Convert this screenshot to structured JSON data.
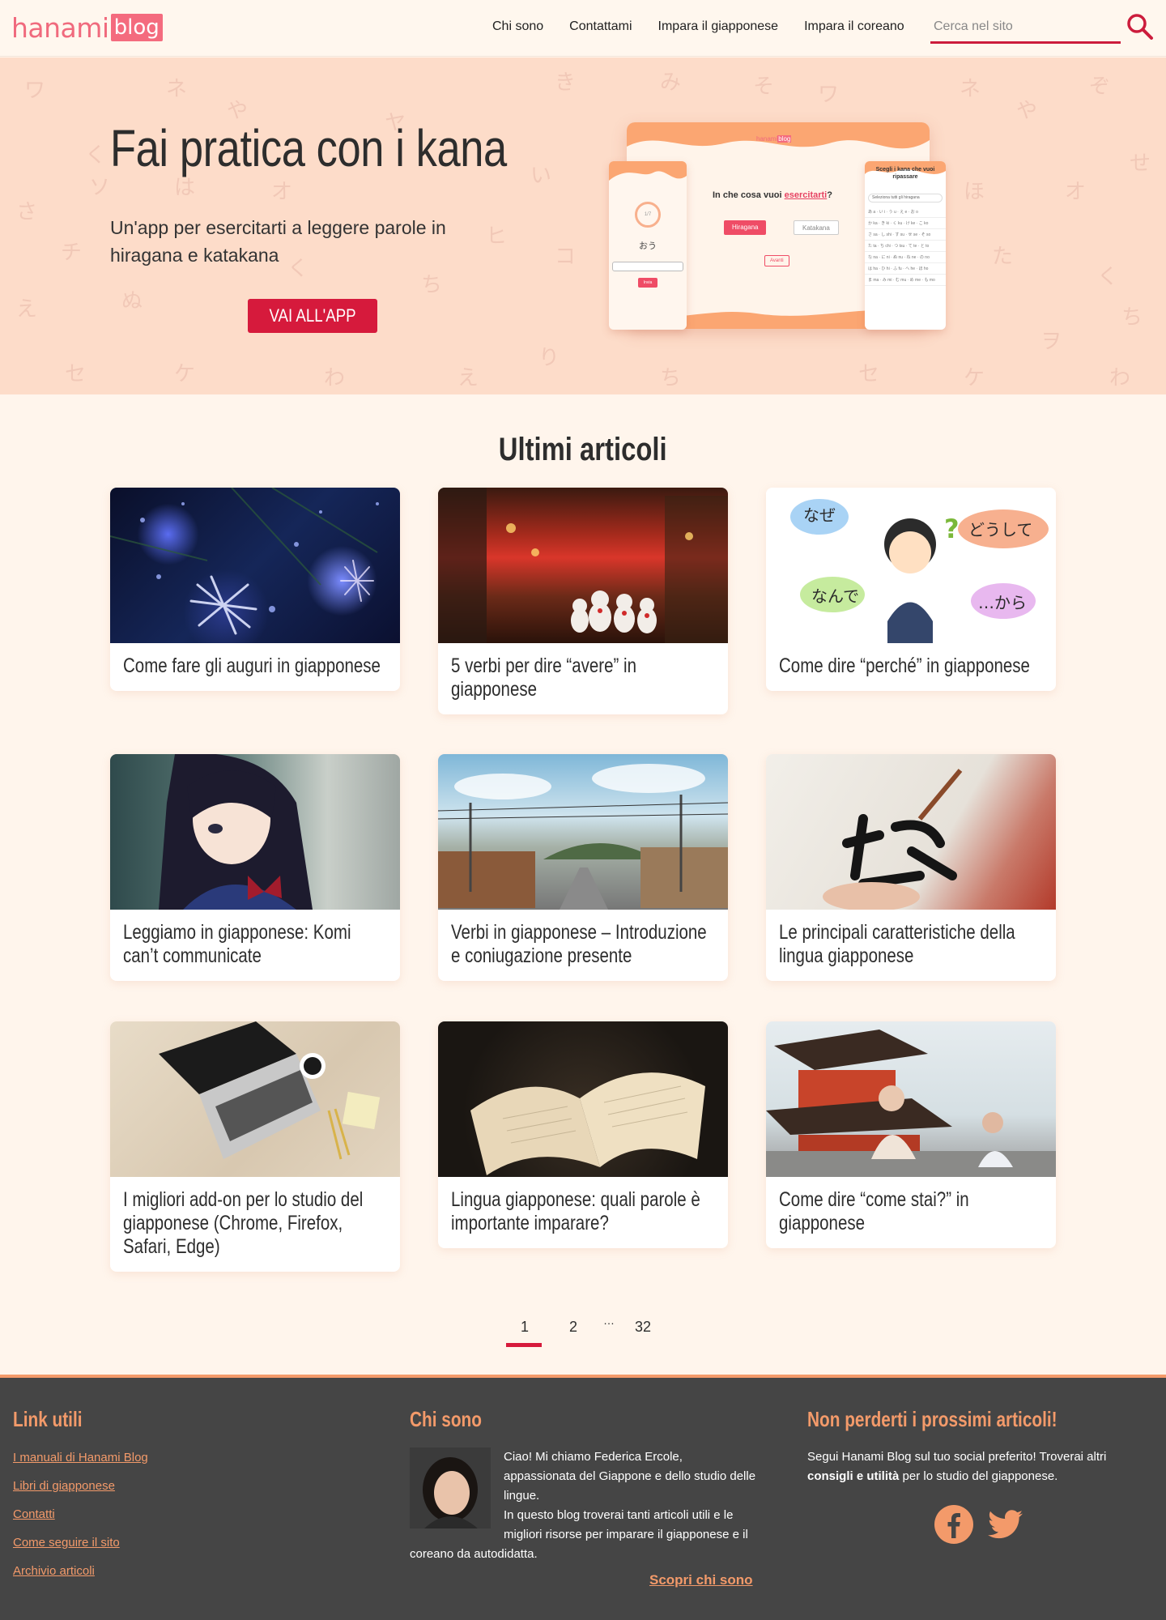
{
  "header": {
    "logo_text": "hanami",
    "logo_badge": "blog",
    "nav": [
      "Chi sono",
      "Contattami",
      "Impara il giapponese",
      "Impara il coreano"
    ],
    "search_placeholder": "Cerca nel sito"
  },
  "hero": {
    "title": "Fai pratica con i kana",
    "subtitle": "Un'app per esercitarti a leggere parole in hiragana e katakana",
    "button": "VAI ALL'APP",
    "mockup": {
      "brand": "hanami",
      "brand_badge": "blog",
      "question_prefix": "In che cosa vuoi ",
      "question_highlight": "esercitarti",
      "question_suffix": "?",
      "option_a": "Hiragana",
      "option_b": "Katakana",
      "next": "Avanti",
      "counter": "1/7",
      "word": "おう",
      "send": "Invia",
      "side_title": "Scegli i kana che vuoi ripassare",
      "select_all": "Seleziona tutti gli hiragana",
      "rows": [
        "あ a · い i · う u · え e · お o",
        "か ka · き ki · く ku · け ke · こ ko",
        "さ sa · し shi · す su · せ se · そ so",
        "た ta · ち chi · つ tsu · て te · と to",
        "な na · に ni · ぬ nu · ね ne · の no",
        "は ha · ひ hi · ふ fu · へ he · ほ ho",
        "ま ma · み mi · む mu · め me · も mo"
      ]
    }
  },
  "articles": {
    "heading": "Ultimi articoli",
    "items": [
      {
        "title": "Come fare gli auguri in giapponese"
      },
      {
        "title": "5 verbi per dire “avere” in giapponese"
      },
      {
        "title": "Come dire “perché” in giapponese",
        "bubbles": [
          "なぜ",
          "どうして",
          "なんで",
          "…から"
        ]
      },
      {
        "title": "Leggiamo in giapponese: Komi can’t communicate"
      },
      {
        "title": "Verbi in giapponese – Introduzione e coniugazione presente"
      },
      {
        "title": "Le principali caratteristiche della lingua giapponese"
      },
      {
        "title": "I migliori add-on per lo studio del giapponese (Chrome, Firefox, Safari, Edge)"
      },
      {
        "title": "Lingua giapponese: quali parole è importante imparare?"
      },
      {
        "title": "Come dire “come stai?” in giapponese"
      }
    ]
  },
  "pagination": {
    "pages": [
      "1",
      "2",
      "…",
      "32"
    ],
    "current": "1"
  },
  "footer": {
    "links_heading": "Link utili",
    "links": [
      "I manuali di Hanami Blog",
      "Libri di giapponese",
      "Contatti",
      "Come seguire il sito",
      "Archivio articoli"
    ],
    "about_heading": "Chi sono",
    "about_text_1": "Ciao! Mi chiamo Federica Ercole, appassionata del Giappone e dello studio delle lingue.",
    "about_text_2": "In questo blog troverai tanti articoli utili e le migliori risorse per imparare il giapponese e il coreano da autodidatta.",
    "about_more": "Scopri chi sono",
    "social_heading": "Non perderti i prossimi articoli!",
    "social_text_1": "Segui Hanami Blog sul tuo social preferito! Troverai altri ",
    "social_text_bold": "consigli e utilità",
    "social_text_2": " per lo studio del giapponese.",
    "social_icons": [
      "facebook-icon",
      "twitter-icon"
    ]
  },
  "colors": {
    "accent": "#d61a3c",
    "footer_accent": "#f39a6a",
    "hero_bg": "#fddcc9",
    "footer_bg": "#454545"
  }
}
